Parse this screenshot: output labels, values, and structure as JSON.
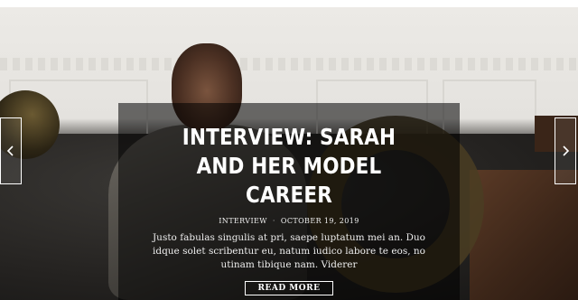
{
  "slide": {
    "title": "INTERVIEW: SARAH AND HER MODEL CAREER",
    "category": "INTERVIEW",
    "date": "OCTOBER 19, 2019",
    "excerpt": "Justo fabulas singulis at pri, saepe luptatum mei an. Duo idque solet scribentur eu, natum iudico labore te eos, no utinam tibique nam. Viderer",
    "read_more_label": "READ MORE"
  },
  "controls": {
    "prev_icon": "chevron-left-icon",
    "next_icon": "chevron-right-icon"
  },
  "colors": {
    "overlay": "rgba(0,0,0,0.55)",
    "text": "#ffffff"
  }
}
